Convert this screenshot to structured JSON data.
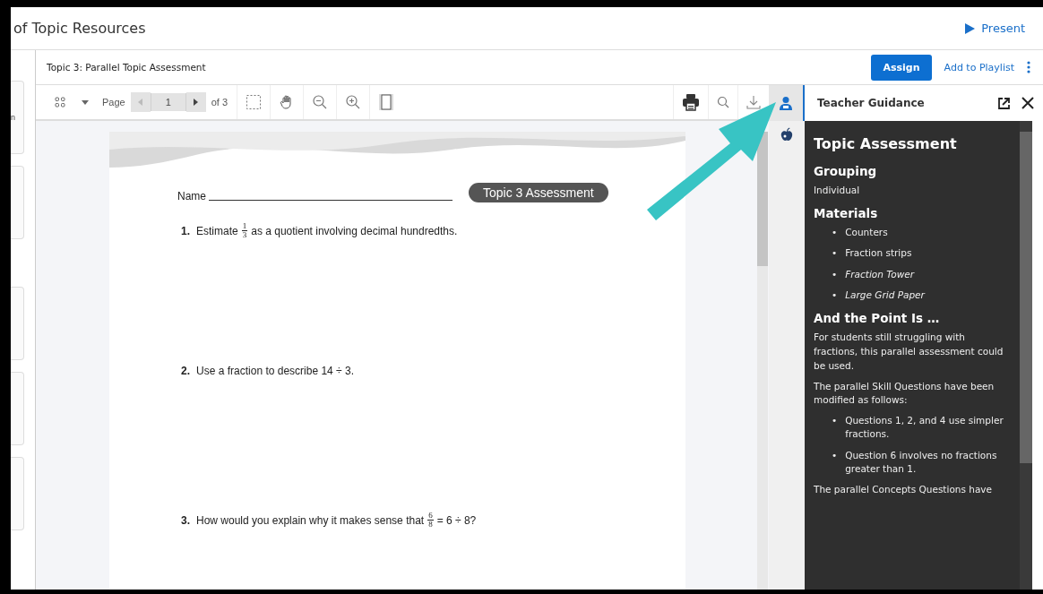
{
  "header": {
    "title_fragment": "of Topic Resources",
    "present": "Present"
  },
  "left_panel": {
    "fragment": "n"
  },
  "resource": {
    "title": "Topic 3: Parallel Topic Assessment",
    "assign": "Assign",
    "add_to_playlist": "Add to Playlist"
  },
  "toolbar": {
    "page_label": "Page",
    "page_value": "1",
    "page_total": "of 3"
  },
  "side_tabs": [
    {
      "kind": "teacher",
      "selected": true
    },
    {
      "kind": "apple",
      "selected": false
    }
  ],
  "document": {
    "name_label": "Name",
    "badge": "Topic 3 Assessment",
    "questions": [
      {
        "number": "1.",
        "before": "Estimate",
        "fraction": {
          "numerator": "1",
          "denominator": "3"
        },
        "after": "as a quotient involving decimal hundredths."
      },
      {
        "number": "2.",
        "before": "Use a fraction to describe 14 ÷ 3."
      },
      {
        "number": "3.",
        "before": "How would you explain why it makes sense that",
        "fraction": {
          "numerator": "6",
          "denominator": "8"
        },
        "after": "= 6 ÷ 8?"
      }
    ]
  },
  "panel": {
    "title": "Teacher Guidance",
    "blocks": [
      {
        "kind": "title",
        "text": "Topic Assessment"
      },
      {
        "kind": "heading",
        "text": "Grouping"
      },
      {
        "kind": "paragraph",
        "text": "Individual"
      },
      {
        "kind": "heading",
        "text": "Materials"
      },
      {
        "kind": "list",
        "items": [
          {
            "marker": "•",
            "text": "Counters",
            "italic": false
          },
          {
            "marker": "•",
            "text": "Fraction strips",
            "italic": false
          },
          {
            "marker": "•",
            "text": "Fraction Tower",
            "italic": true
          },
          {
            "marker": "•",
            "text": "Large Grid Paper",
            "italic": true
          }
        ]
      },
      {
        "kind": "heading",
        "text": "And the Point Is …"
      },
      {
        "kind": "paragraph",
        "text": "For students still struggling with fractions, this parallel assessment could be used."
      },
      {
        "kind": "paragraph",
        "text": "The parallel Skill Questions have been modified as follows:"
      },
      {
        "kind": "list",
        "items": [
          {
            "marker": "•",
            "text": "Questions 1, 2, and 4 use simpler fractions.",
            "italic": false
          },
          {
            "marker": "•",
            "text": "Question 6 involves no fractions greater than 1.",
            "italic": false
          }
        ]
      },
      {
        "kind": "paragraph",
        "text": "The parallel Concepts Questions have"
      }
    ]
  }
}
